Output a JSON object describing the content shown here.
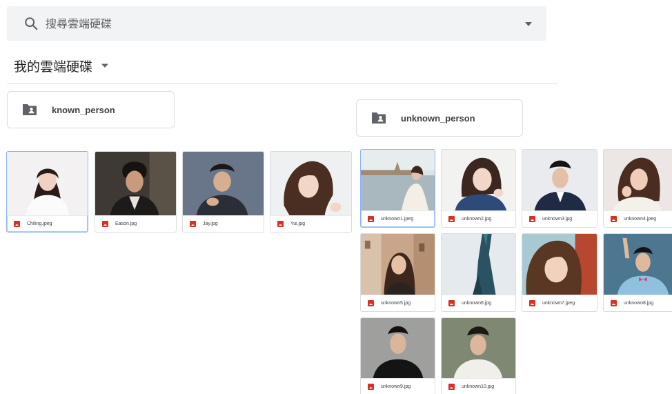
{
  "search": {
    "placeholder": "搜尋雲端硬碟",
    "icon": "search-icon",
    "options_icon": "caret-down-icon"
  },
  "drive": {
    "title": "我的雲端硬碟",
    "caret_icon": "caret-down-icon"
  },
  "folders": [
    {
      "name": "known_person",
      "icon": "shared-folder-icon"
    },
    {
      "name": "unknown_person",
      "icon": "shared-folder-icon"
    }
  ],
  "known_files": [
    {
      "name": "Chiling.jpeg",
      "selected": true
    },
    {
      "name": "Eason.jpg"
    },
    {
      "name": "Jay.jpg"
    },
    {
      "name": "Yui.jpg"
    }
  ],
  "unknown_files": [
    {
      "name": "unknown1.jpeg",
      "selected": true
    },
    {
      "name": "unknown2.jpg"
    },
    {
      "name": "unknown3.jpg"
    },
    {
      "name": "unknown4.jpeg"
    },
    {
      "name": "unknown5.jpg"
    },
    {
      "name": "unknown6.jpg"
    },
    {
      "name": "unknown7.jpeg"
    },
    {
      "name": "unknown8.jpg"
    },
    {
      "name": "unknown9.jpg"
    },
    {
      "name": "unknown10.jpg"
    }
  ],
  "colors": {
    "search_bg": "#f1f3f4",
    "image_file_icon": "#d93025",
    "selected_border": "#8ab4f8",
    "folder_icon": "#5f6368"
  }
}
